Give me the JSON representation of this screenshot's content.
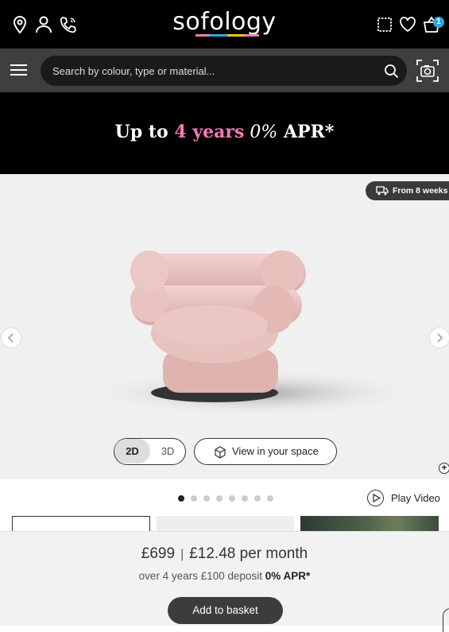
{
  "header": {
    "logo": "sofology",
    "logo_stripe_colors": [
      "#f07bb4",
      "#2aa8e0",
      "#f5c518",
      "#f07bb4"
    ],
    "icons": [
      "location-icon",
      "account-icon",
      "phone-icon",
      "swatch-icon",
      "wishlist-icon",
      "basket-icon"
    ],
    "basket_count": "1"
  },
  "search": {
    "placeholder": "Search by colour, type or material..."
  },
  "promo": {
    "prefix": "Up to ",
    "highlight": "4 years",
    "italic": " 0%",
    "suffix": " APR*",
    "highlight_color": "#f07bb4"
  },
  "gallery": {
    "delivery_label": "From 8 weeks",
    "toggle_2d": "2D",
    "toggle_3d": "3D",
    "view_space_label": "View in your space",
    "dot_count": 8,
    "active_dot": 0,
    "play_label": "Play Video"
  },
  "buy": {
    "price": "£699",
    "monthly": "£12.48 per month",
    "finance_text": "over 4 years £100 deposit ",
    "finance_bold": "0% APR*",
    "add_label": "Add to basket"
  }
}
